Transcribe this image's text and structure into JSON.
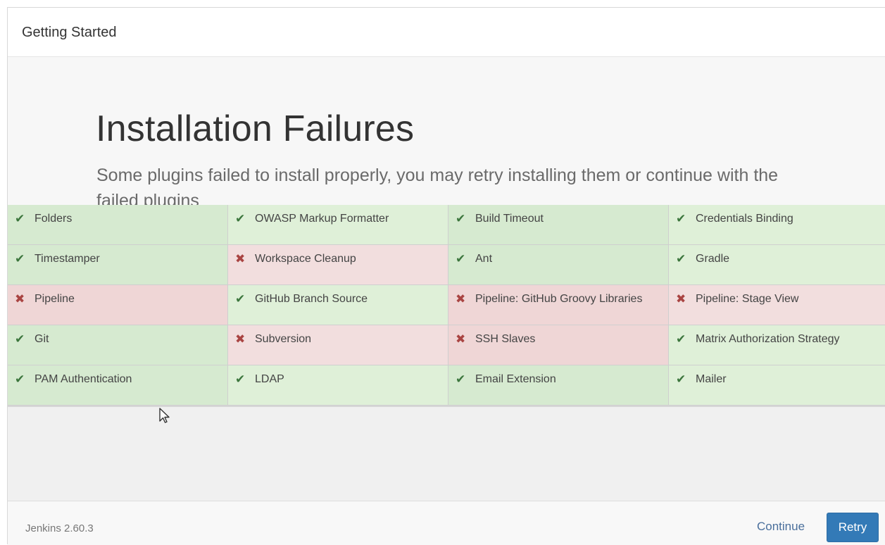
{
  "header": {
    "title": "Getting Started"
  },
  "hero": {
    "title": "Installation Failures",
    "subtitle": "Some plugins failed to install properly, you may retry installing them or continue with the failed plugins"
  },
  "status_colors": {
    "success": "#dff0d8",
    "fail": "#f2dede",
    "success_icon": "#3c763d",
    "fail_icon": "#a94442"
  },
  "icons": {
    "success": "✔",
    "fail": "✖"
  },
  "plugins": [
    {
      "name": "Folders",
      "status": "success"
    },
    {
      "name": "OWASP Markup Formatter",
      "status": "success"
    },
    {
      "name": "Build Timeout",
      "status": "success"
    },
    {
      "name": "Credentials Binding",
      "status": "success"
    },
    {
      "name": "Timestamper",
      "status": "success"
    },
    {
      "name": "Workspace Cleanup",
      "status": "fail"
    },
    {
      "name": "Ant",
      "status": "success"
    },
    {
      "name": "Gradle",
      "status": "success"
    },
    {
      "name": "Pipeline",
      "status": "fail"
    },
    {
      "name": "GitHub Branch Source",
      "status": "success"
    },
    {
      "name": "Pipeline: GitHub Groovy Libraries",
      "status": "fail"
    },
    {
      "name": "Pipeline: Stage View",
      "status": "fail"
    },
    {
      "name": "Git",
      "status": "success"
    },
    {
      "name": "Subversion",
      "status": "fail"
    },
    {
      "name": "SSH Slaves",
      "status": "fail"
    },
    {
      "name": "Matrix Authorization Strategy",
      "status": "success"
    },
    {
      "name": "PAM Authentication",
      "status": "success"
    },
    {
      "name": "LDAP",
      "status": "success"
    },
    {
      "name": "Email Extension",
      "status": "success"
    },
    {
      "name": "Mailer",
      "status": "success"
    }
  ],
  "footer": {
    "version": "Jenkins 2.60.3",
    "continue_label": "Continue",
    "retry_label": "Retry"
  }
}
